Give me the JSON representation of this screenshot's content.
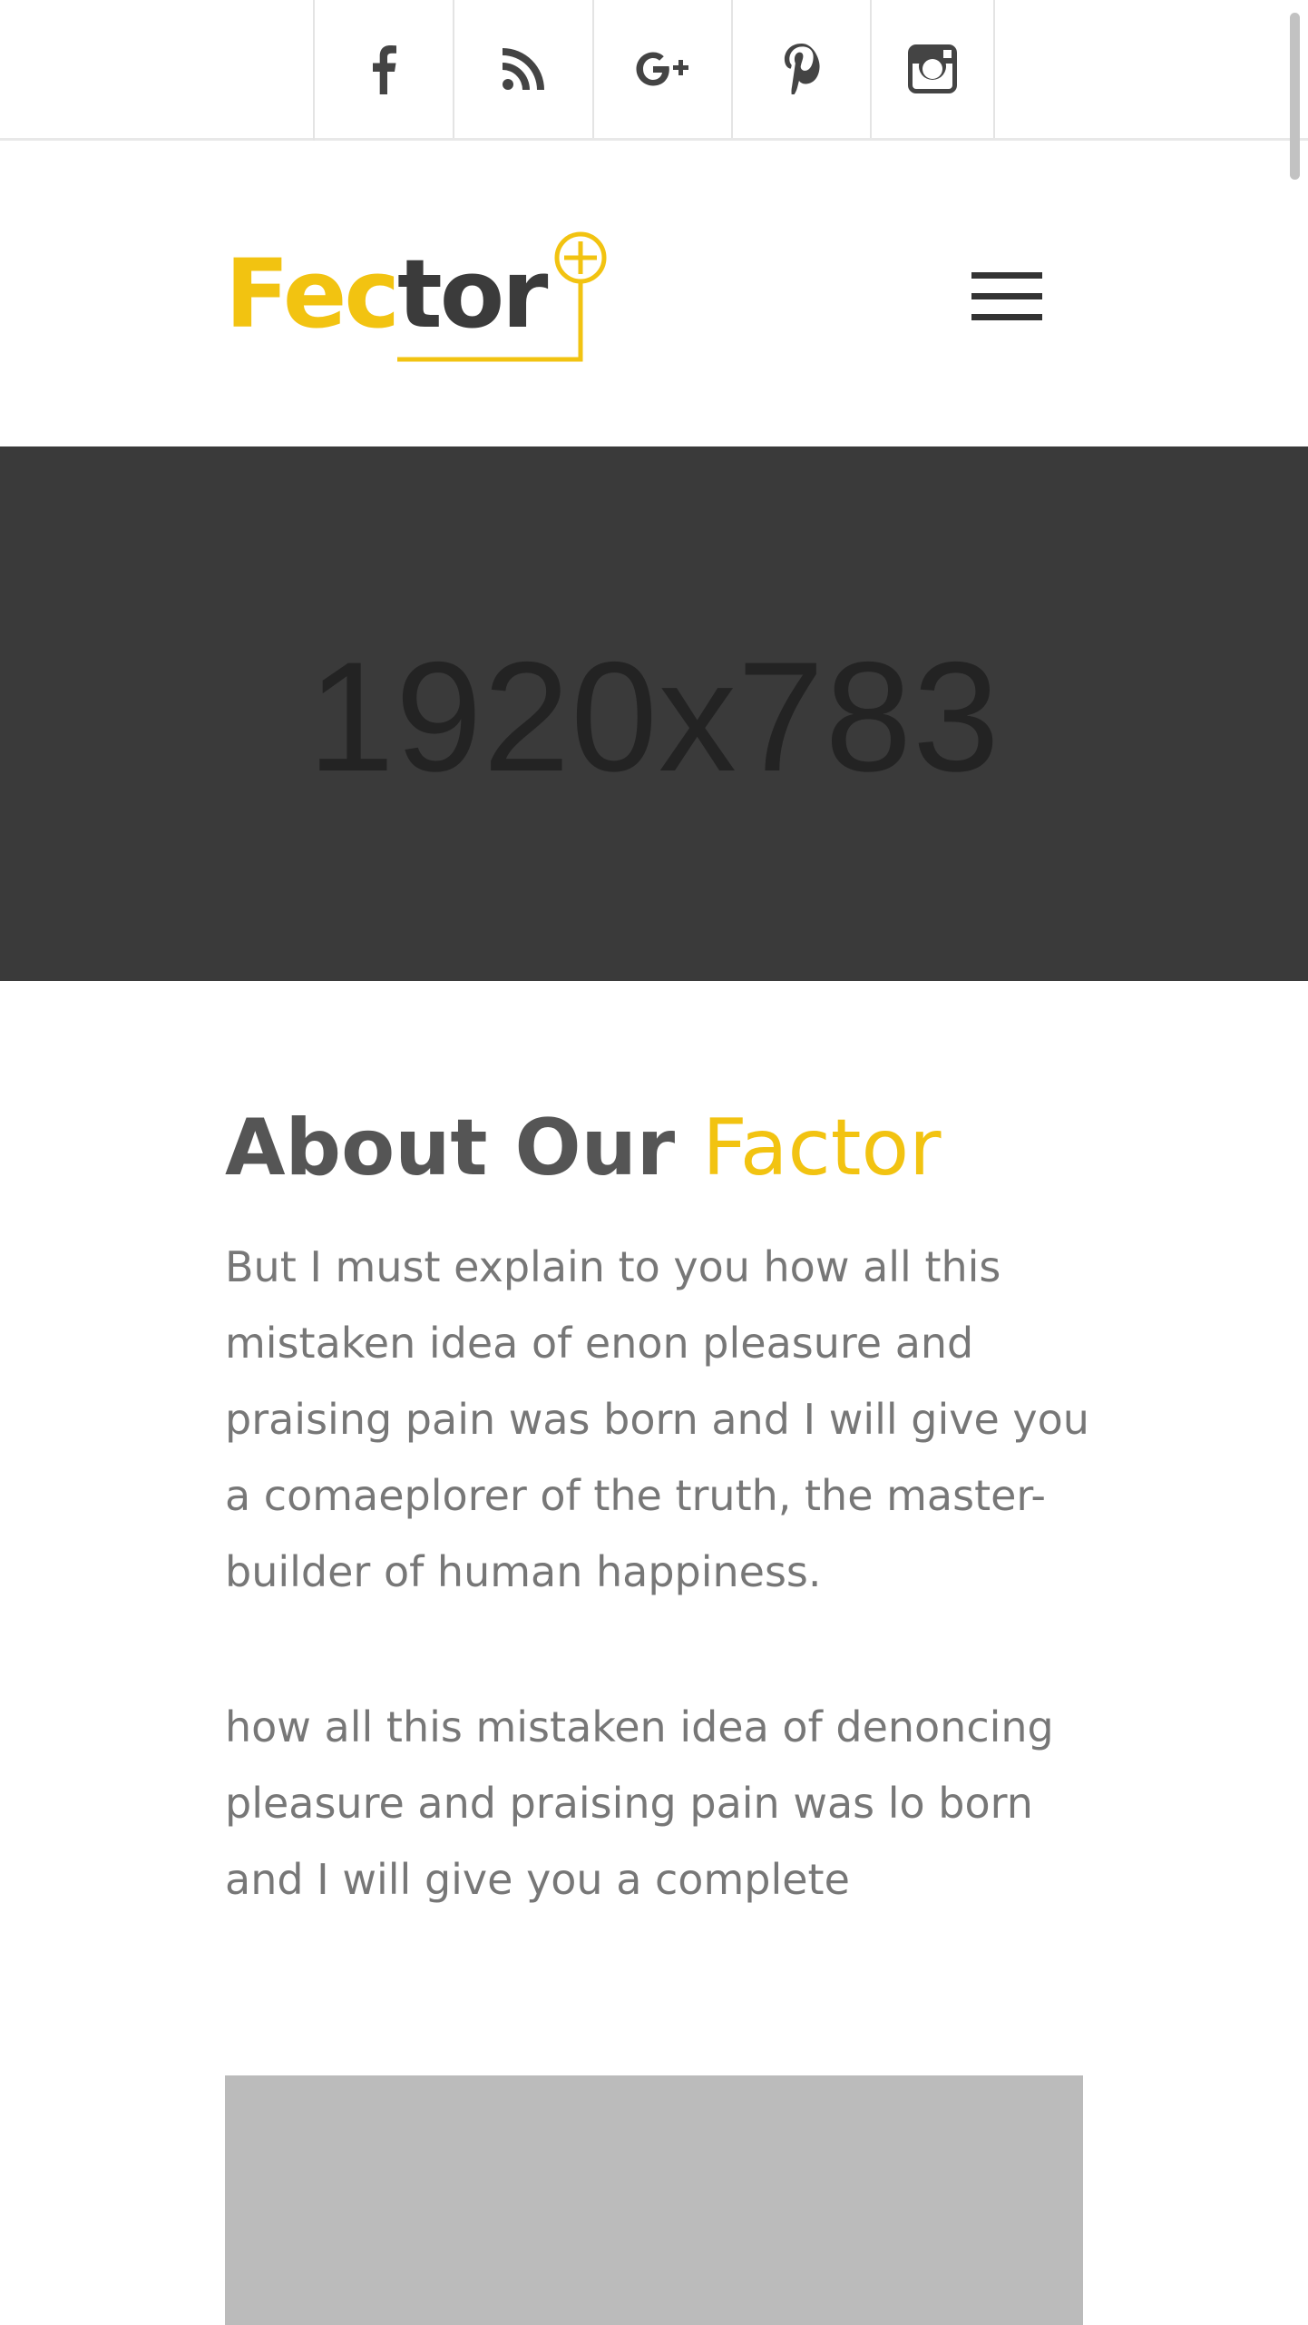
{
  "social": [
    {
      "name": "facebook",
      "icon": "facebook-icon"
    },
    {
      "name": "rss",
      "icon": "rss-icon"
    },
    {
      "name": "google-plus",
      "icon": "google-plus-icon",
      "text": "G+"
    },
    {
      "name": "pinterest",
      "icon": "pinterest-icon"
    },
    {
      "name": "instagram",
      "icon": "instagram-icon"
    }
  ],
  "header": {
    "logo": {
      "part1": "Fec",
      "part2": "tor"
    },
    "menu_icon": "hamburger-menu-icon"
  },
  "hero": {
    "placeholder_text": "1920x783"
  },
  "about": {
    "title_main": "About Our",
    "title_accent": "Factor",
    "paragraph_1": "But I must explain to you how all this mistaken idea of enon pleasure and praising pain was born and I will give you a comaeplorer of the truth, the master-builder of human happiness.",
    "paragraph_2": "how all this mistaken idea of denoncing pleasure and praising pain was lo born and I will give you a complete"
  },
  "colors": {
    "accent": "#f2c311",
    "dark": "#3b3b3b",
    "hero_bg": "#3a3a3a",
    "text": "#777777",
    "placeholder_bg": "#bbbbbb"
  }
}
